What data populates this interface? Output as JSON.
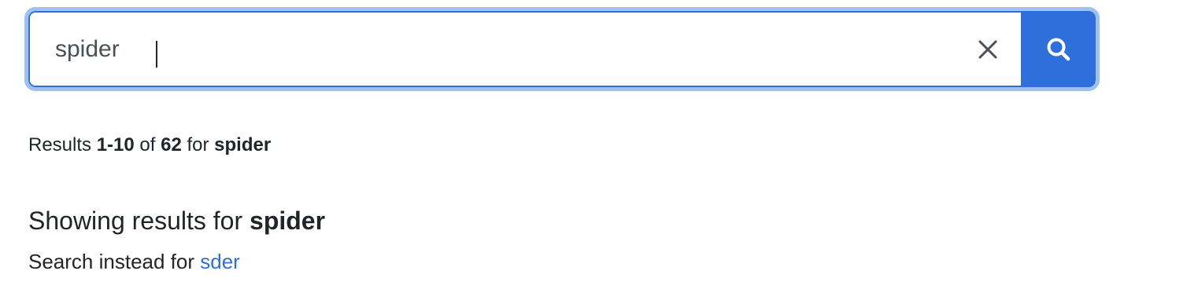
{
  "search": {
    "value": "spider",
    "clear_icon": "close-icon",
    "submit_icon": "search-icon",
    "accent_color": "#2f6fdc",
    "focus_ring_color": "#9ec0f3"
  },
  "results_summary": {
    "prefix": "Results",
    "range": "1-10",
    "of_label": "of",
    "total": "62",
    "for_label": "for",
    "query": "spider"
  },
  "correction": {
    "showing_label": "Showing results for",
    "corrected_query": "spider",
    "instead_label": "Search instead for",
    "original_query": "sder",
    "link_color": "#2f6fdc"
  }
}
